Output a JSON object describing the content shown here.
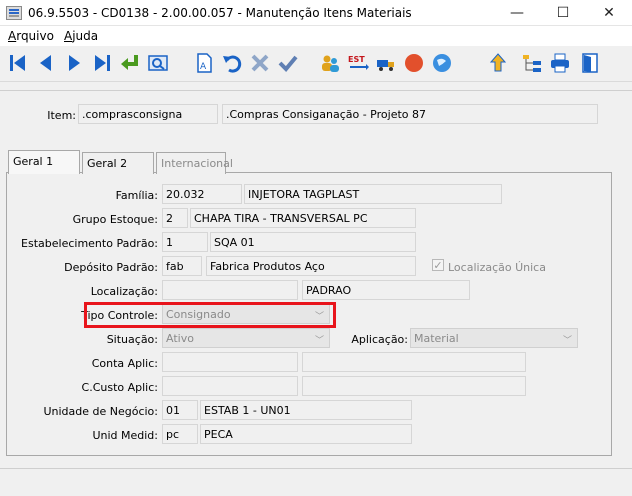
{
  "window": {
    "title": "06.9.5503 - CD0138 - 2.00.00.057 - Manutenção Itens Materiais",
    "minimize": "—",
    "maximize": "☐",
    "close": "✕"
  },
  "menu": [
    {
      "first": "A",
      "rest": "rquivo"
    },
    {
      "first": "A",
      "rest": "juda"
    }
  ],
  "toolbar_icons": [
    "first-record-icon",
    "previous-record-icon",
    "next-record-icon",
    "last-record-icon",
    "enter-icon",
    "search-icon",
    "new-document-icon",
    "undo-icon",
    "delete-icon",
    "confirm-icon",
    "users-icon",
    "est-icon",
    "transport-icon",
    "stop-icon",
    "globe-icon",
    "upload-icon",
    "tree-icon",
    "print-icon",
    "exit-icon"
  ],
  "toolbar_est_label": "EST",
  "item": {
    "label": "Item:",
    "code": ".comprasconsigna",
    "description": ".Compras Consiganação - Projeto 87"
  },
  "tabs": [
    "Geral 1",
    "Geral 2",
    "Internacional"
  ],
  "form": {
    "familia": {
      "label": "Família:",
      "code": "20.032",
      "desc": "INJETORA TAGPLAST"
    },
    "grupo_estoque": {
      "label": "Grupo Estoque:",
      "code": "2",
      "desc": "CHAPA TIRA   - TRANSVERSAL  PC"
    },
    "estabelecimento": {
      "label": "Estabelecimento Padrão:",
      "code": "1",
      "desc": "SQA 01"
    },
    "deposito": {
      "label": "Depósito Padrão:",
      "code": "fab",
      "desc": "Fabrica Produtos Aço"
    },
    "localizacao_unica": {
      "label": "Localização Única",
      "checked": true
    },
    "localizacao": {
      "label": "Localização:",
      "code": "",
      "desc": "PADRAO"
    },
    "tipo_controle": {
      "label": "Tipo Controle:",
      "value": "Consignado"
    },
    "situacao": {
      "label": "Situação:",
      "value": "Ativo"
    },
    "aplicacao": {
      "label": "Aplicação:",
      "value": "Material"
    },
    "conta_aplic": {
      "label": "Conta Aplic:",
      "code": "",
      "desc": ""
    },
    "ccusto_aplic": {
      "label": "C.Custo Aplic:",
      "code": "",
      "desc": ""
    },
    "unidade_negocio": {
      "label": "Unidade de Negócio:",
      "code": "01",
      "desc": "ESTAB 1 - UN01"
    },
    "unid_medid": {
      "label": "Unid Medid:",
      "code": "pc",
      "desc": "PECA"
    }
  },
  "colors": {
    "highlight": "#e8141c",
    "accent_blue": "#1a63c6"
  }
}
